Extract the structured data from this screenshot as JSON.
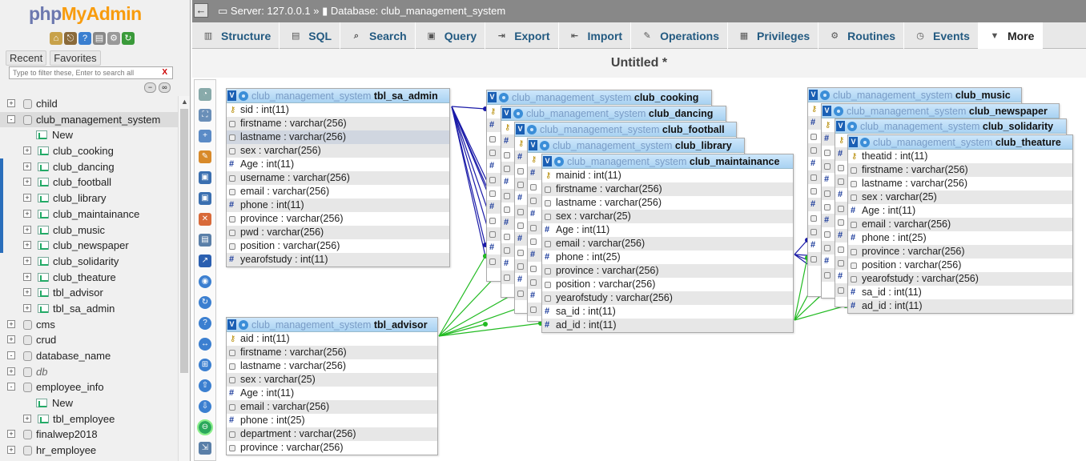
{
  "logo": {
    "part1": "php",
    "part2": "MyAdmin"
  },
  "nav_tabs": {
    "recent": "Recent",
    "favorites": "Favorites"
  },
  "filter": {
    "placeholder": "Type to filter these, Enter to search all",
    "clear": "X"
  },
  "tree": [
    {
      "label": "child",
      "level": 0,
      "kind": "db",
      "toggle": "+"
    },
    {
      "label": "club_management_system",
      "level": 0,
      "kind": "db",
      "toggle": "-",
      "selected": true
    },
    {
      "label": "New",
      "level": 1,
      "kind": "new"
    },
    {
      "label": "club_cooking",
      "level": 1,
      "kind": "table",
      "toggle": "+"
    },
    {
      "label": "club_dancing",
      "level": 1,
      "kind": "table",
      "toggle": "+"
    },
    {
      "label": "club_football",
      "level": 1,
      "kind": "table",
      "toggle": "+"
    },
    {
      "label": "club_library",
      "level": 1,
      "kind": "table",
      "toggle": "+"
    },
    {
      "label": "club_maintainance",
      "level": 1,
      "kind": "table",
      "toggle": "+"
    },
    {
      "label": "club_music",
      "level": 1,
      "kind": "table",
      "toggle": "+"
    },
    {
      "label": "club_newspaper",
      "level": 1,
      "kind": "table",
      "toggle": "+"
    },
    {
      "label": "club_solidarity",
      "level": 1,
      "kind": "table",
      "toggle": "+"
    },
    {
      "label": "club_theature",
      "level": 1,
      "kind": "table",
      "toggle": "+"
    },
    {
      "label": "tbl_advisor",
      "level": 1,
      "kind": "table",
      "toggle": "+"
    },
    {
      "label": "tbl_sa_admin",
      "level": 1,
      "kind": "table",
      "toggle": "+"
    },
    {
      "label": "cms",
      "level": 0,
      "kind": "db",
      "toggle": "+"
    },
    {
      "label": "crud",
      "level": 0,
      "kind": "db",
      "toggle": "+"
    },
    {
      "label": "database_name",
      "level": 0,
      "kind": "db",
      "toggle": "-"
    },
    {
      "label": "db",
      "level": 0,
      "kind": "db-italic",
      "toggle": "+"
    },
    {
      "label": "employee_info",
      "level": 0,
      "kind": "db",
      "toggle": "-"
    },
    {
      "label": "New",
      "level": 1,
      "kind": "new"
    },
    {
      "label": "tbl_employee",
      "level": 1,
      "kind": "table",
      "toggle": "+"
    },
    {
      "label": "finalwep2018",
      "level": 0,
      "kind": "db",
      "toggle": "+"
    },
    {
      "label": "hr_employee",
      "level": 0,
      "kind": "db",
      "toggle": "+"
    }
  ],
  "breadcrumb": {
    "server": "Server: 127.0.0.1",
    "sep": "»",
    "database": "Database: club_management_system"
  },
  "tabs": [
    {
      "label": "Structure",
      "icon": "structure-icon",
      "glyph": "▥"
    },
    {
      "label": "SQL",
      "icon": "sql-icon",
      "glyph": "▤"
    },
    {
      "label": "Search",
      "icon": "search-icon",
      "glyph": "⌕"
    },
    {
      "label": "Query",
      "icon": "query-icon",
      "glyph": "▣"
    },
    {
      "label": "Export",
      "icon": "export-icon",
      "glyph": "⇥"
    },
    {
      "label": "Import",
      "icon": "import-icon",
      "glyph": "⇤"
    },
    {
      "label": "Operations",
      "icon": "wrench-icon",
      "glyph": "✎"
    },
    {
      "label": "Privileges",
      "icon": "privileges-icon",
      "glyph": "▦"
    },
    {
      "label": "Routines",
      "icon": "routines-icon",
      "glyph": "⚙"
    },
    {
      "label": "Events",
      "icon": "clock-icon",
      "glyph": "◷"
    },
    {
      "label": "More",
      "icon": "chevron-down-icon",
      "glyph": "▼",
      "active": true
    }
  ],
  "designer_title": "Untitled *",
  "db_prefix": "club_management_system",
  "tables": [
    {
      "id": "tbl_sa_admin",
      "name": "tbl_sa_admin",
      "columns": [
        {
          "name": "sid : int(11)",
          "key": "primary"
        },
        {
          "name": "firstname : varchar(256)",
          "key": "text"
        },
        {
          "name": "lastname : varchar(256)",
          "key": "text",
          "highlight": true
        },
        {
          "name": "sex : varchar(256)",
          "key": "text"
        },
        {
          "name": "Age : int(11)",
          "key": "num"
        },
        {
          "name": "username : varchar(256)",
          "key": "text"
        },
        {
          "name": "email : varchar(256)",
          "key": "text"
        },
        {
          "name": "phone : int(11)",
          "key": "num"
        },
        {
          "name": "province : varchar(256)",
          "key": "text"
        },
        {
          "name": "pwd : varchar(256)",
          "key": "text"
        },
        {
          "name": "position : varchar(256)",
          "key": "text"
        },
        {
          "name": "yearofstudy : int(11)",
          "key": "num"
        }
      ]
    },
    {
      "id": "tbl_advisor",
      "name": "tbl_advisor",
      "columns": [
        {
          "name": "aid : int(11)",
          "key": "primary"
        },
        {
          "name": "firstname : varchar(256)",
          "key": "text"
        },
        {
          "name": "lastname : varchar(256)",
          "key": "text"
        },
        {
          "name": "sex : varchar(25)",
          "key": "text"
        },
        {
          "name": "Age : int(11)",
          "key": "num"
        },
        {
          "name": "email : varchar(256)",
          "key": "text"
        },
        {
          "name": "phone : int(25)",
          "key": "num"
        },
        {
          "name": "department : varchar(256)",
          "key": "text"
        },
        {
          "name": "province : varchar(256)",
          "key": "text"
        }
      ]
    },
    {
      "id": "club_cooking",
      "name": "club_cooking",
      "columns": []
    },
    {
      "id": "club_dancing",
      "name": "club_dancing",
      "columns": []
    },
    {
      "id": "club_football",
      "name": "club_football",
      "columns": []
    },
    {
      "id": "club_library",
      "name": "club_library",
      "columns": []
    },
    {
      "id": "club_maintainance",
      "name": "club_maintainance",
      "columns": [
        {
          "name": "mainid : int(11)",
          "key": "primary"
        },
        {
          "name": "firstname : varchar(256)",
          "key": "text"
        },
        {
          "name": "lastname : varchar(256)",
          "key": "text"
        },
        {
          "name": "sex : varchar(25)",
          "key": "text"
        },
        {
          "name": "Age : int(11)",
          "key": "num"
        },
        {
          "name": "email : varchar(256)",
          "key": "text"
        },
        {
          "name": "phone : int(25)",
          "key": "num"
        },
        {
          "name": "province : varchar(256)",
          "key": "text"
        },
        {
          "name": "position : varchar(256)",
          "key": "text"
        },
        {
          "name": "yearofstudy : varchar(256)",
          "key": "text"
        },
        {
          "name": "sa_id : int(11)",
          "key": "num"
        },
        {
          "name": "ad_id : int(11)",
          "key": "num"
        }
      ]
    },
    {
      "id": "club_music",
      "name": "club_music",
      "columns": []
    },
    {
      "id": "club_newspaper",
      "name": "club_newspaper",
      "columns": []
    },
    {
      "id": "club_solidarity",
      "name": "club_solidarity",
      "columns": []
    },
    {
      "id": "club_theature",
      "name": "club_theature",
      "columns": [
        {
          "name": "theatid : int(11)",
          "key": "primary"
        },
        {
          "name": "firstname : varchar(256)",
          "key": "text"
        },
        {
          "name": "lastname : varchar(256)",
          "key": "text"
        },
        {
          "name": "sex : varchar(25)",
          "key": "text"
        },
        {
          "name": "Age : int(11)",
          "key": "num"
        },
        {
          "name": "email : varchar(256)",
          "key": "text"
        },
        {
          "name": "phone : int(25)",
          "key": "num"
        },
        {
          "name": "province : varchar(256)",
          "key": "text"
        },
        {
          "name": "position : varchar(256)",
          "key": "text"
        },
        {
          "name": "yearofstudy : varchar(256)",
          "key": "text"
        },
        {
          "name": "sa_id : int(11)",
          "key": "num"
        },
        {
          "name": "ad_id : int(11)",
          "key": "num"
        }
      ]
    }
  ],
  "colors": {
    "admin_relation": "#1a1aa8",
    "advisor_relation": "#22bb22",
    "header_blue": "#a9d2f2",
    "tab_text": "#235a81"
  }
}
